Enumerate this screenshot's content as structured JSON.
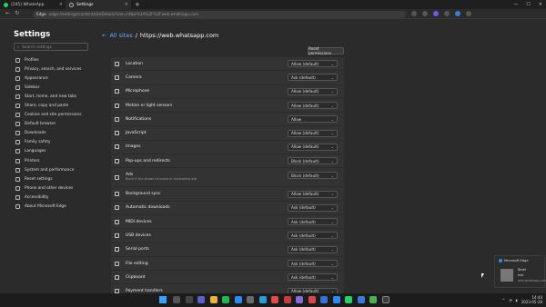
{
  "tabs": [
    {
      "label": "(245) WhatsApp",
      "icon": "whatsapp-icon"
    },
    {
      "label": "Settings",
      "icon": "gear-icon"
    }
  ],
  "address": {
    "browser": "Edge",
    "url": "edge://settings/content/siteDetails?site=https%3A%2F%2Fweb.whatsapp.com"
  },
  "sidebar": {
    "title": "Settings",
    "search_placeholder": "Search settings",
    "items": [
      "Profiles",
      "Privacy, search, and services",
      "Appearance",
      "Sidebar",
      "Start, home, and new tabs",
      "Share, copy and paste",
      "Cookies and site permissions",
      "Default browser",
      "Downloads",
      "Family safety",
      "Languages",
      "Printers",
      "System and performance",
      "Reset settings",
      "Phone and other devices",
      "Accessibility",
      "About Microsoft Edge"
    ]
  },
  "main": {
    "breadcrumb_link": "All sites",
    "breadcrumb_sep": "/",
    "breadcrumb_current": "https://web.whatsapp.com",
    "reset_label": "Reset permissions",
    "permissions": [
      {
        "label": "Location",
        "value": "Allow (default)",
        "icon": "location-icon"
      },
      {
        "label": "Camera",
        "value": "Ask (default)",
        "icon": "camera-icon"
      },
      {
        "label": "Microphone",
        "value": "Allow (default)",
        "icon": "microphone-icon"
      },
      {
        "label": "Motion or light sensors",
        "value": "Allow (default)",
        "icon": "sensor-icon"
      },
      {
        "label": "Notifications",
        "value": "Allow",
        "icon": "bell-icon"
      },
      {
        "label": "JavaScript",
        "value": "Allow (default)",
        "icon": "javascript-icon"
      },
      {
        "label": "Images",
        "value": "Allow (default)",
        "icon": "image-icon"
      },
      {
        "label": "Pop-ups and redirects",
        "value": "Block (default)",
        "icon": "popup-icon"
      },
      {
        "label": "Ads",
        "value": "Block (default)",
        "icon": "ads-icon",
        "sub": "Block if site shows intrusive or misleading ads"
      },
      {
        "label": "Background sync",
        "value": "Allow (default)",
        "icon": "sync-icon"
      },
      {
        "label": "Automatic downloads",
        "value": "Ask (default)",
        "icon": "download-icon"
      },
      {
        "label": "MIDI devices",
        "value": "Ask (default)",
        "icon": "midi-icon"
      },
      {
        "label": "USB devices",
        "value": "Ask (default)",
        "icon": "usb-icon"
      },
      {
        "label": "Serial ports",
        "value": "Ask (default)",
        "icon": "serial-icon"
      },
      {
        "label": "File editing",
        "value": "Ask (default)",
        "icon": "file-icon"
      },
      {
        "label": "Clipboard",
        "value": "Ask (default)",
        "icon": "clipboard-icon"
      },
      {
        "label": "Payment handlers",
        "value": "Allow (default)",
        "icon": "payment-icon"
      }
    ]
  },
  "notification": {
    "app": "Microsoft Edge",
    "title": "Sinai",
    "body": "test",
    "source": "web.whatsapp.com"
  },
  "clock": {
    "time": "14:44",
    "date": "2023-05-28"
  },
  "colors": {
    "accent": "#6ba7ff",
    "whatsapp": "#25d366",
    "windows": "#3aa0ff"
  }
}
